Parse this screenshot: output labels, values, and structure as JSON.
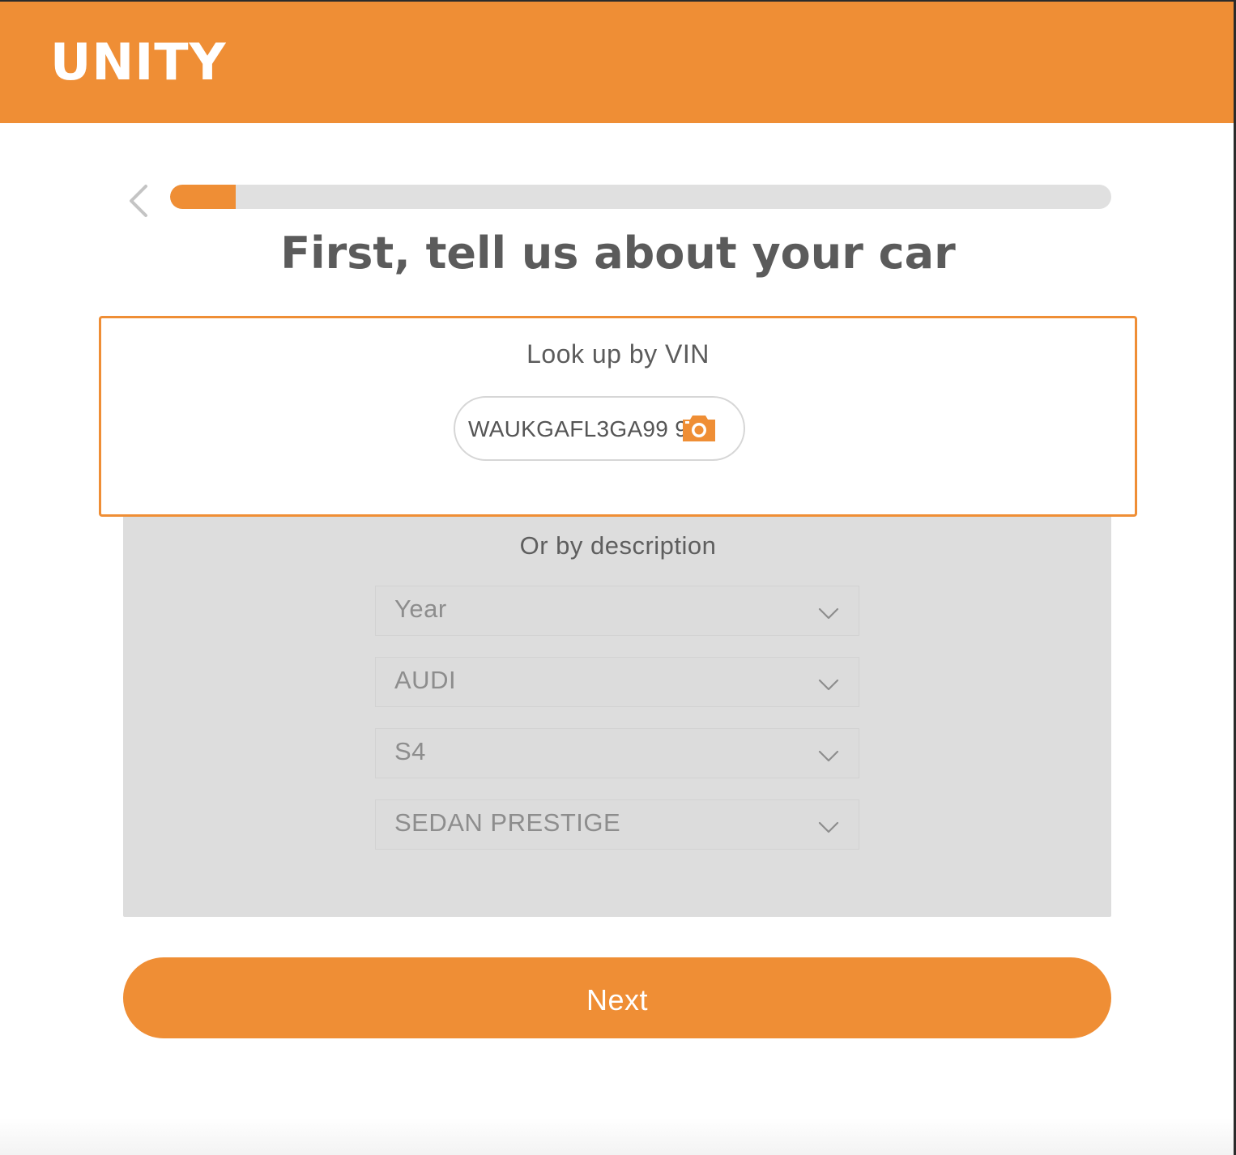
{
  "app": {
    "logo": "UNITY"
  },
  "progress": {
    "percent": 7
  },
  "page": {
    "title": "First, tell us about your car"
  },
  "vin_section": {
    "label": "Look up by VIN",
    "value": "WAUKGAFL3GA99 9 9"
  },
  "description_section": {
    "label": "Or by description",
    "selects": [
      {
        "value": "Year"
      },
      {
        "value": "AUDI"
      },
      {
        "value": "S4"
      },
      {
        "value": "SEDAN PRESTIGE"
      }
    ]
  },
  "actions": {
    "next_label": "Next"
  },
  "colors": {
    "brand": "#ef8e35",
    "track": "#e0e0e0",
    "panel": "#dddddd",
    "text": "#5b5b5b"
  },
  "icons": {
    "back": "chevron-left-icon",
    "camera": "camera-icon",
    "dropdown": "chevron-down-icon"
  }
}
